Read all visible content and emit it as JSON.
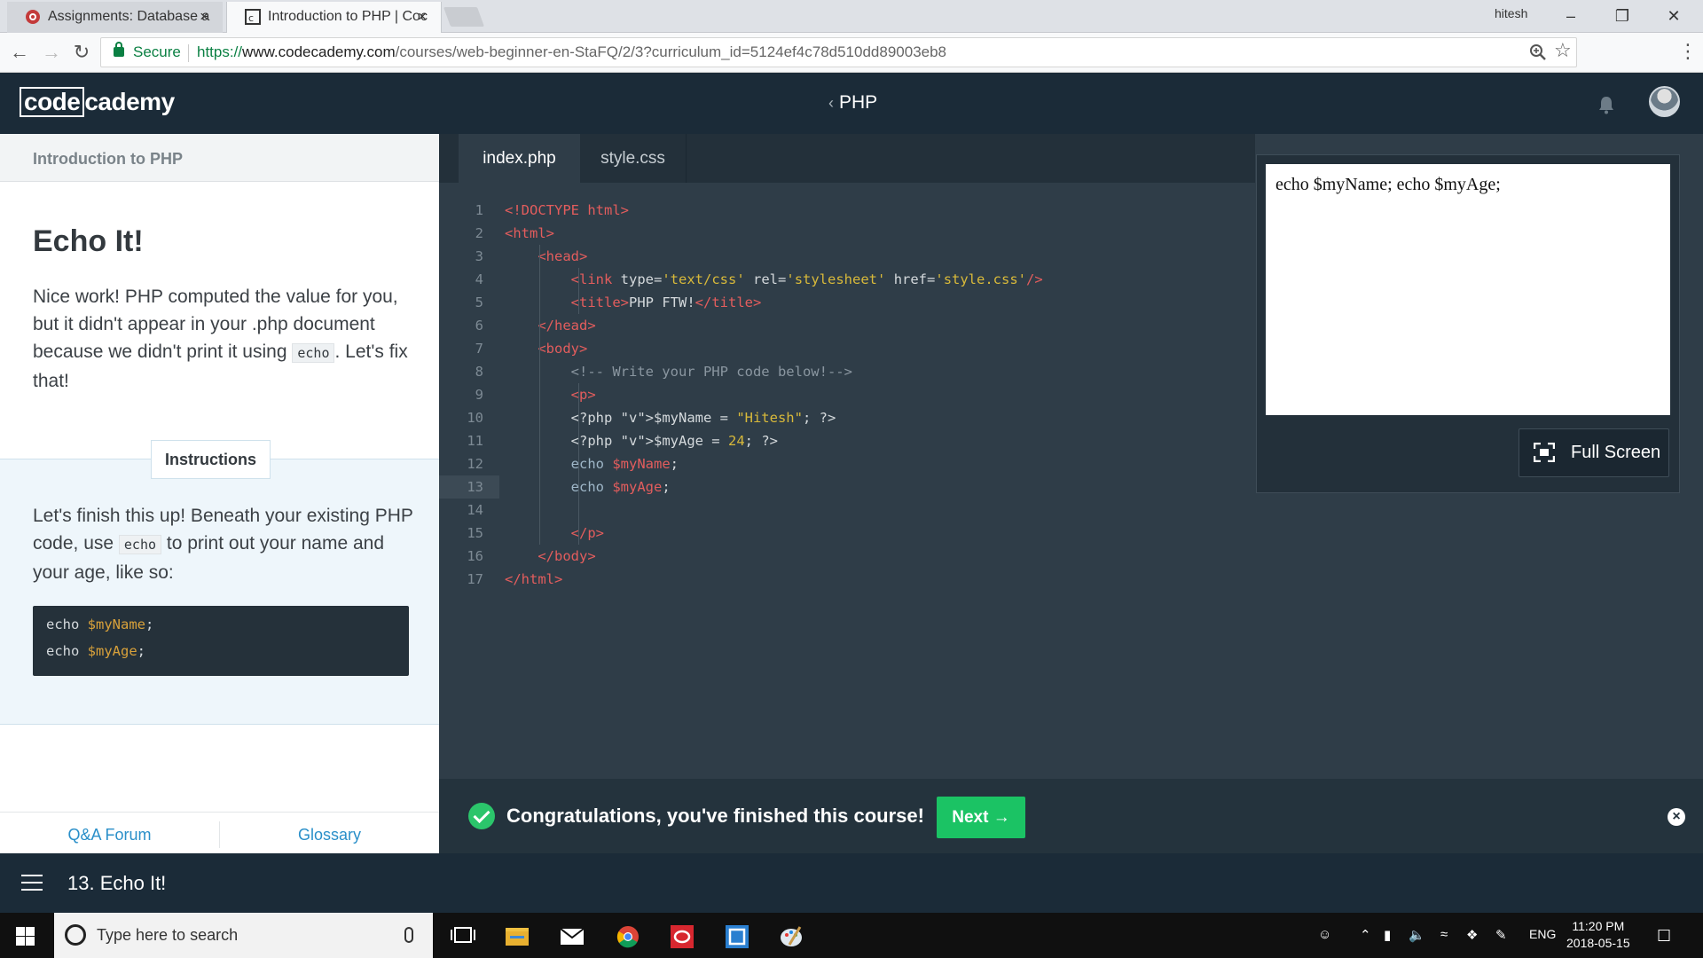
{
  "browser": {
    "tabs": [
      {
        "title": "Assignments: Database a",
        "icon": "asu-logo-icon",
        "active": false
      },
      {
        "title": "Introduction to PHP | Coc",
        "icon": "codecademy-favicon-icon",
        "active": true
      }
    ],
    "window_user": "hitesh",
    "window_controls": [
      "minimize-icon",
      "restore-icon",
      "close-icon"
    ],
    "secure_label": "Secure",
    "url_scheme": "https://",
    "url_host": "www.codecademy.com",
    "url_path": "/courses/web-beginner-en-StaFQ/2/3?curriculum_id=5124ef4c78d510dd89003eb8"
  },
  "header": {
    "logo_boxed": "code",
    "logo_rest": "cademy",
    "course_back_glyph": "‹",
    "course_title": "PHP"
  },
  "lesson": {
    "section": "Introduction to PHP",
    "title": "Echo It!",
    "body_before_code": "Nice work! PHP computed the value for you, but it didn't appear in your .php document because we didn't print it using ",
    "body_code": "echo",
    "body_after_code": ". Let's fix that!",
    "instructions_tab": "Instructions",
    "instr_before_code": "Let's finish this up! Beneath your existing PHP code, use ",
    "instr_code": "echo",
    "instr_after_code": " to print out your name and your age, like so:",
    "snippet": [
      {
        "kw": "echo",
        "var": "$myName",
        "end": ";"
      },
      {
        "kw": "echo",
        "var": "$myAge",
        "end": ";"
      }
    ],
    "footer_links": [
      "Q&A Forum",
      "Glossary"
    ]
  },
  "editor": {
    "tabs": [
      "index.php",
      "style.css"
    ],
    "active_tab": "index.php",
    "active_line": 13,
    "lines": [
      "<!DOCTYPE html>",
      "<html>",
      "    <head>",
      "        <link type='text/css' rel='stylesheet' href='style.css'/>",
      "        <title>PHP FTW!</title>",
      "    </head>",
      "    <body>",
      "        <!-- Write your PHP code below!-->",
      "        <p>",
      "        <?php $myName = \"Hitesh\"; ?>",
      "        <?php $myAge = 24; ?>",
      "        echo $myName;",
      "        echo $myAge;",
      "",
      "        </p>",
      "    </body>",
      "</html>"
    ]
  },
  "preview": {
    "output": "echo $myName; echo $myAge;",
    "fullscreen_label": "Full Screen"
  },
  "congrats": {
    "message": "Congratulations, you've finished this course!",
    "next_label": "Next →",
    "close_glyph": "×"
  },
  "bottom_nav": {
    "exercise": "13. Echo It!"
  },
  "taskbar": {
    "search_placeholder": "Type here to search",
    "language": "ENG",
    "time": "11:20 PM",
    "date": "2018-05-15"
  },
  "colors": {
    "header_bg": "#1b2b38",
    "editor_bg": "#2f3d48",
    "tag": "#e35d5d",
    "string": "#d8b93a",
    "link_blue": "#2a8fc9",
    "next_green": "#1bc364"
  }
}
